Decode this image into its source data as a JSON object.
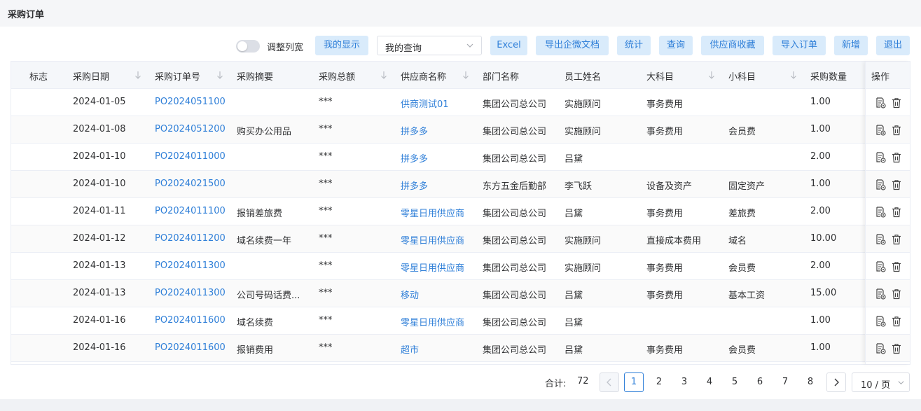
{
  "page": {
    "title": "采购订单"
  },
  "toolbar": {
    "adjust_width_label": "调整列宽",
    "my_display": "我的显示",
    "my_query": "我的查询",
    "excel": "Excel",
    "export_wecom": "导出企微文档",
    "stats": "统计",
    "query": "查询",
    "supplier_fav": "供应商收藏",
    "import_order": "导入订单",
    "add": "新增",
    "exit": "退出"
  },
  "table": {
    "headers": {
      "flag": "标志",
      "date": "采购日期",
      "order_no": "采购订单号",
      "summary": "采购摘要",
      "total": "采购总额",
      "supplier": "供应商名称",
      "dept": "部门名称",
      "employee": "员工姓名",
      "major": "大科目",
      "minor": "小科目",
      "qty": "采购数量",
      "ops": "操作"
    },
    "rows": [
      {
        "date": "2024-01-05",
        "order_no": "PO2024051100",
        "summary": "",
        "total": "***",
        "supplier": "供商测试01",
        "dept": "集团公司总公司",
        "employee": "实施顾问",
        "major": "事务费用",
        "minor": "",
        "qty": "1.00"
      },
      {
        "date": "2024-01-08",
        "order_no": "PO2024051200",
        "summary": "购买办公用品",
        "total": "***",
        "supplier": "拼多多",
        "dept": "集团公司总公司",
        "employee": "实施顾问",
        "major": "事务费用",
        "minor": "会员费",
        "qty": "1.00"
      },
      {
        "date": "2024-01-10",
        "order_no": "PO2024011000",
        "summary": "",
        "total": "***",
        "supplier": "拼多多",
        "dept": "集团公司总公司",
        "employee": "吕黛",
        "major": "",
        "minor": "",
        "qty": "2.00"
      },
      {
        "date": "2024-01-10",
        "order_no": "PO2024021500",
        "summary": "",
        "total": "***",
        "supplier": "拼多多",
        "dept": "东方五金后勤部",
        "employee": "李飞跃",
        "major": "设备及资产",
        "minor": "固定资产",
        "qty": "1.00"
      },
      {
        "date": "2024-01-11",
        "order_no": "PO2024011100",
        "summary": "报销差旅费",
        "total": "***",
        "supplier": "零星日用供应商",
        "dept": "集团公司总公司",
        "employee": "吕黛",
        "major": "事务费用",
        "minor": "差旅费",
        "qty": "2.00"
      },
      {
        "date": "2024-01-12",
        "order_no": "PO2024011200",
        "summary": "域名续费一年",
        "total": "***",
        "supplier": "零星日用供应商",
        "dept": "集团公司总公司",
        "employee": "实施顾问",
        "major": "直接成本费用",
        "minor": "域名",
        "qty": "10.00"
      },
      {
        "date": "2024-01-13",
        "order_no": "PO2024011300",
        "summary": "",
        "total": "***",
        "supplier": "零星日用供应商",
        "dept": "集团公司总公司",
        "employee": "实施顾问",
        "major": "事务费用",
        "minor": "会员费",
        "qty": "2.00"
      },
      {
        "date": "2024-01-13",
        "order_no": "PO2024011300",
        "summary": "公司号码话费...",
        "total": "***",
        "supplier": "移动",
        "dept": "集团公司总公司",
        "employee": "吕黛",
        "major": "事务费用",
        "minor": "基本工资",
        "qty": "15.00"
      },
      {
        "date": "2024-01-16",
        "order_no": "PO2024011600",
        "summary": "域名续费",
        "total": "***",
        "supplier": "零星日用供应商",
        "dept": "集团公司总公司",
        "employee": "吕黛",
        "major": "",
        "minor": "",
        "qty": "1.00"
      },
      {
        "date": "2024-01-16",
        "order_no": "PO2024011600",
        "summary": "报销费用",
        "total": "***",
        "supplier": "超市",
        "dept": "集团公司总公司",
        "employee": "吕黛",
        "major": "事务费用",
        "minor": "会员费",
        "qty": "1.00"
      }
    ],
    "row_icons": [
      "document-view-icon",
      "trash-icon"
    ]
  },
  "pagination": {
    "total_label": "合计:",
    "total": "72",
    "pages": [
      "1",
      "2",
      "3",
      "4",
      "5",
      "6",
      "7",
      "8"
    ],
    "current": "1",
    "page_size": "10 / 页"
  },
  "colors": {
    "accent": "#2f7fd8",
    "button_bg": "#d9ebfb",
    "header_bg": "#f5f7fa"
  }
}
